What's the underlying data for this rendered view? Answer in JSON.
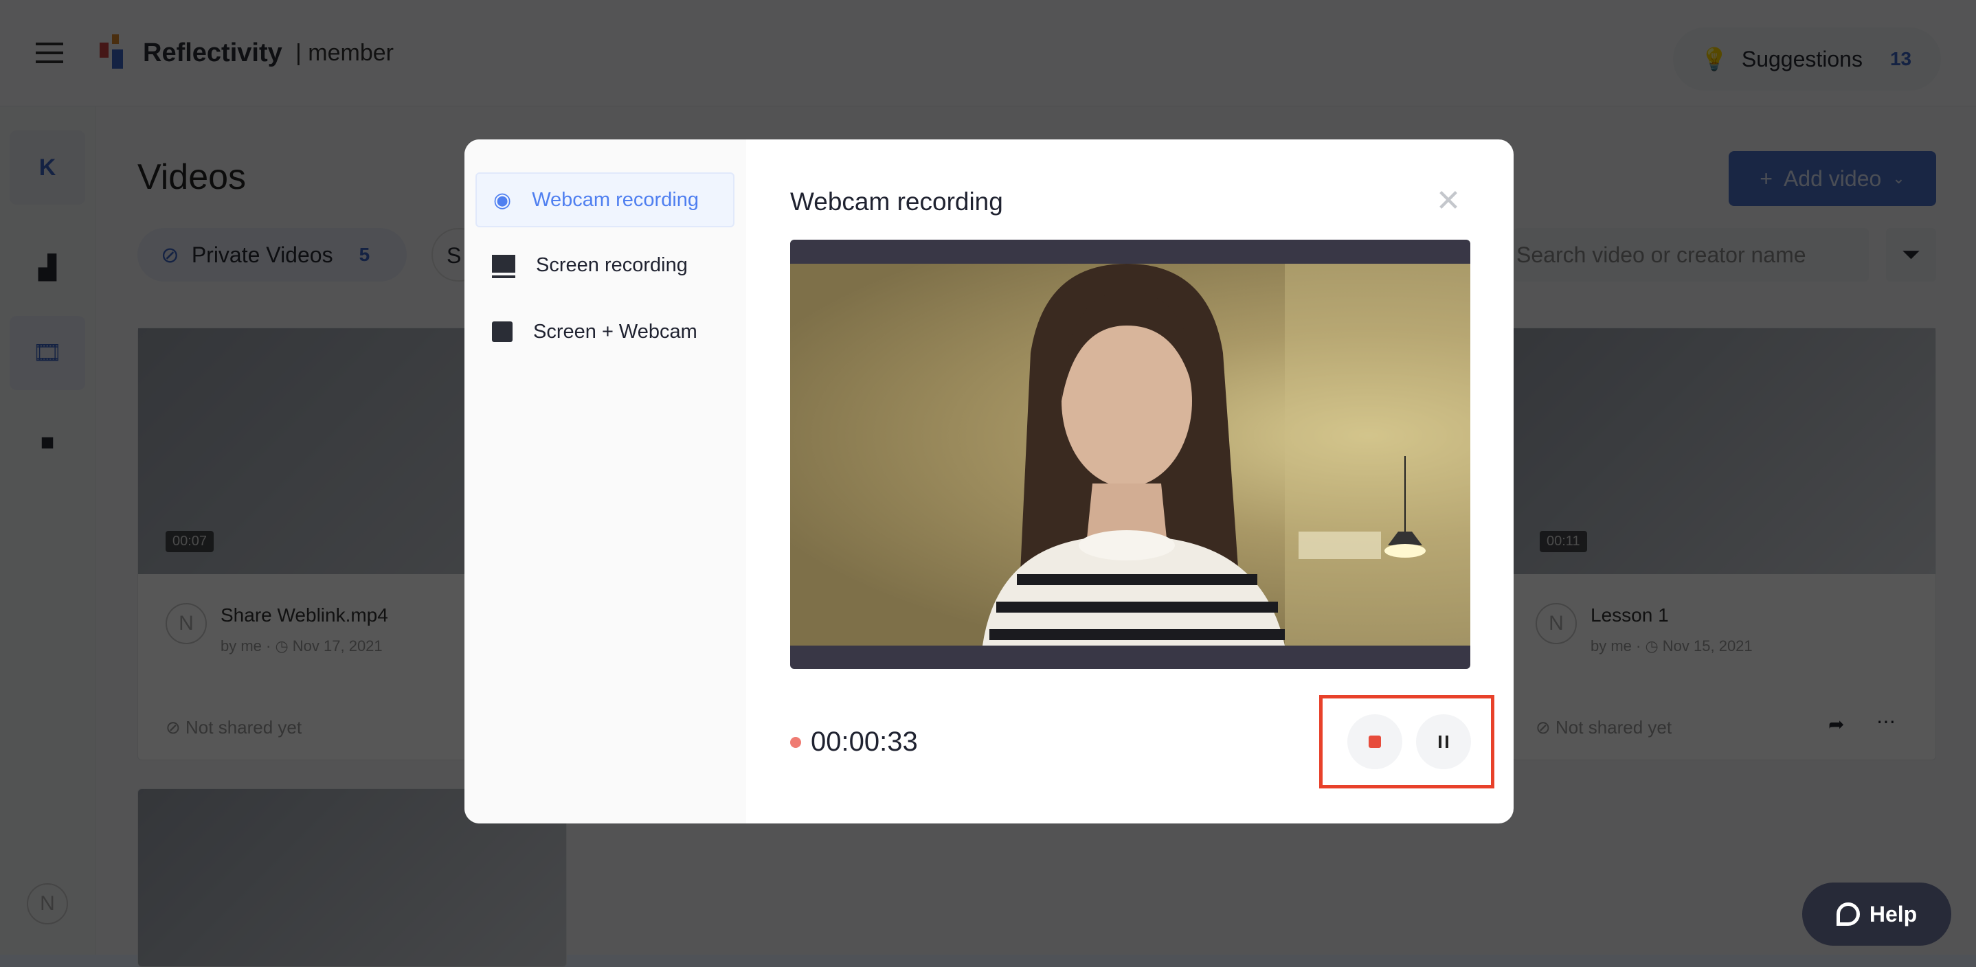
{
  "header": {
    "brand": "Reflectivity",
    "brand_sub": "| member",
    "suggestions_label": "Suggestions",
    "suggestions_count": "13"
  },
  "sidebar": {
    "workspace_initial": "K"
  },
  "page": {
    "title": "Videos",
    "filter_pill_label": "Private Videos",
    "filter_pill_count": "5",
    "second_pill_label": "S",
    "add_video_label": "Add video",
    "search_placeholder": "Search video or creator name"
  },
  "cards": [
    {
      "duration": "00:07",
      "title": "Share Weblink.mp4",
      "author": "by me",
      "date": "Nov 17, 2021",
      "share_status": "Not shared yet"
    },
    {
      "duration": "00:11",
      "title": "Lesson 1",
      "author": "by me",
      "date": "Nov 15, 2021",
      "share_status": "Not shared yet"
    }
  ],
  "modal": {
    "menu": [
      {
        "label": "Webcam recording",
        "icon": "webcam-icon",
        "active": true
      },
      {
        "label": "Screen recording",
        "icon": "laptop-icon"
      },
      {
        "label": "Screen + Webcam",
        "icon": "screen-webcam-icon"
      }
    ],
    "title": "Webcam recording",
    "timer": "00:00:33",
    "colors": {
      "accent": "#4f7ff0",
      "recording": "#e74c3c",
      "highlight": "#e8412a"
    }
  },
  "help": {
    "label": "Help"
  }
}
